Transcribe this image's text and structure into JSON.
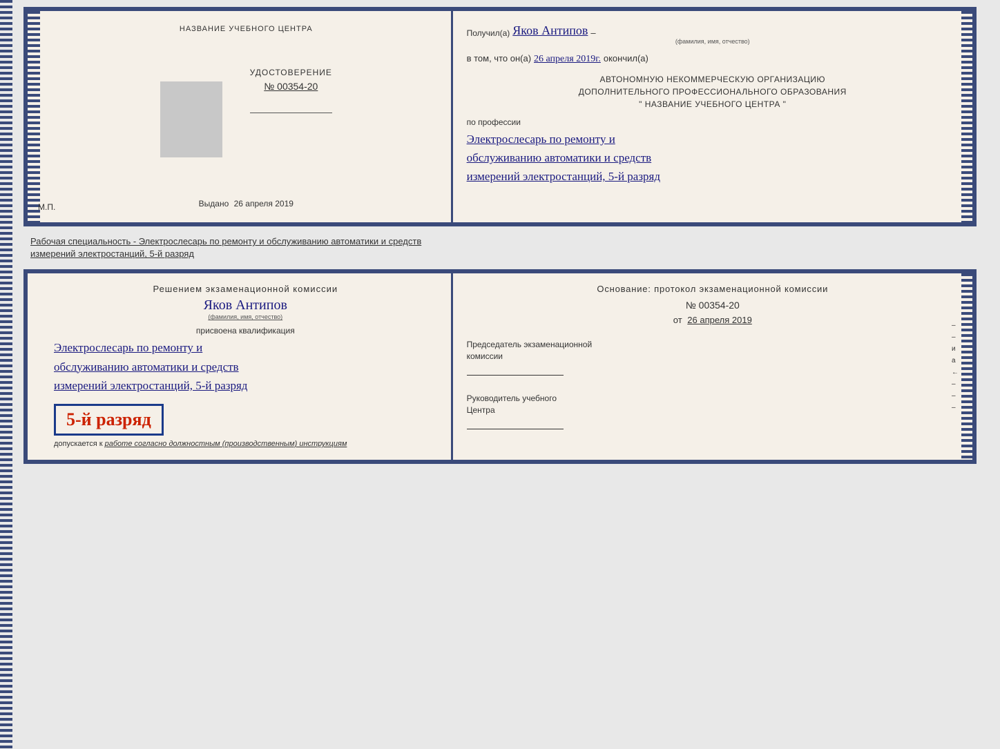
{
  "top_spread": {
    "left_page": {
      "title": "НАЗВАНИЕ УЧЕБНОГО ЦЕНТРА",
      "udost_title": "УДОСТОВЕРЕНИЕ",
      "udost_number": "№ 00354-20",
      "vydano_label": "Выдано",
      "vydano_date": "26 апреля 2019",
      "mp_label": "М.П."
    },
    "right_page": {
      "poluchil_label": "Получил(а)",
      "recipient_name": "Яков Антипов",
      "fio_label": "(фамилия, имя, отчество)",
      "v_tom_label": "в том, что он(а)",
      "date_value": "26 апреля 2019г.",
      "okonchil_label": "окончил(а)",
      "org_line1": "АВТОНОМНУЮ НЕКОММЕРЧЕСКУЮ ОРГАНИЗАЦИЮ",
      "org_line2": "ДОПОЛНИТЕЛЬНОГО ПРОФЕССИОНАЛЬНОГО ОБРАЗОВАНИЯ",
      "org_quote": "\"    НАЗВАНИЕ УЧЕБНОГО ЦЕНТРА    \"",
      "po_professii_label": "по профессии",
      "profession_line1": "Электрослесарь по ремонту и",
      "profession_line2": "обслуживанию автоматики и средств",
      "profession_line3": "измерений электростанций, 5-й разряд"
    }
  },
  "middle_text": {
    "line1": "Рабочая специальность - Электрослесарь по ремонту и обслуживанию автоматики и средств",
    "line2": "измерений электростанций, 5-й разряд"
  },
  "bottom_spread": {
    "left_page": {
      "resheniem_label": "Решением экзаменационной комиссии",
      "recipient_name": "Яков Антипов",
      "fio_label": "(фамилия, имя, отчество)",
      "prisvoena_label": "присвоена квалификация",
      "qualification_line1": "Электрослесарь по ремонту и",
      "qualification_line2": "обслуживанию автоматики и средств",
      "qualification_line3": "измерений электростанций, 5-й разряд",
      "razryad_badge": "5-й разряд",
      "dopuskaetsya_label": "допускается к",
      "dopuskaetsya_text": "работе согласно должностным (производственным) инструкциям"
    },
    "right_page": {
      "osnovanie_label": "Основание: протокол экзаменационной комиссии",
      "number_label": "№ 00354-20",
      "ot_label": "от",
      "ot_date": "26 апреля 2019",
      "predsedatel_line1": "Председатель экзаменационной",
      "predsedatel_line2": "комиссии",
      "rukovoditel_line1": "Руководитель учебного",
      "rukovoditel_line2": "Центра"
    }
  },
  "colors": {
    "border": "#3a4a7a",
    "handwriting": "#1a1a80",
    "badge_red": "#cc2200",
    "badge_border": "#1a3a8a",
    "paper": "#f5f0e8",
    "text": "#333333"
  }
}
